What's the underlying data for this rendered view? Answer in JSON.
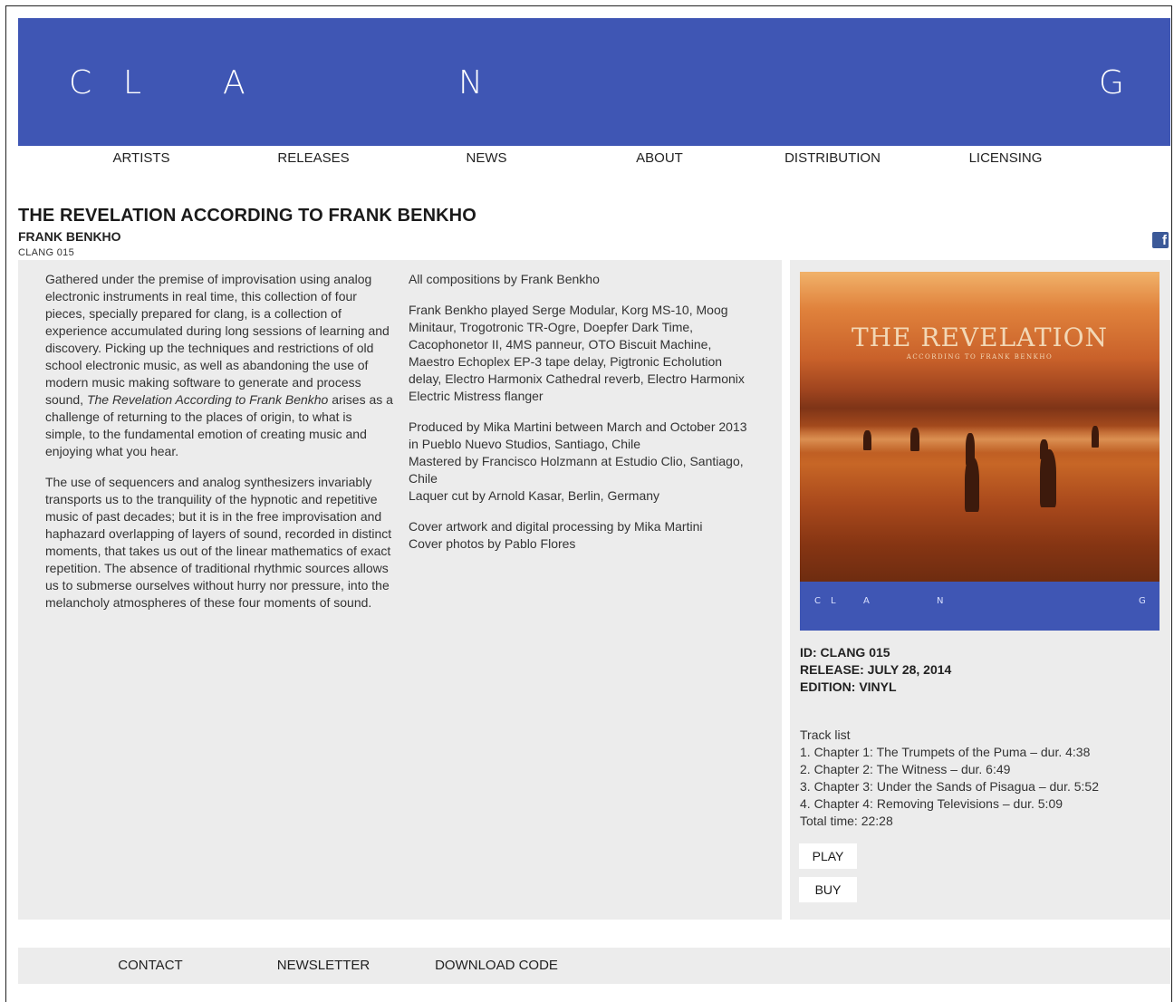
{
  "header": {
    "logo_letters": [
      "C",
      "L",
      "A",
      "N",
      "G"
    ]
  },
  "nav": {
    "items": [
      "ARTISTS",
      "RELEASES",
      "NEWS",
      "ABOUT",
      "DISTRIBUTION",
      "LICENSING"
    ]
  },
  "release": {
    "title": "THE REVELATION ACCORDING TO FRANK BENKHO",
    "artist": "FRANK BENKHO",
    "catalog": "CLANG 015"
  },
  "share": {
    "facebook_glyph": "f",
    "icon": "facebook-icon",
    "color": "#3b5998"
  },
  "description": {
    "p1_before": "Gathered under the premise of improvisation using analog electronic instruments in real time, this collection of four pieces, specially prepared for clang, is a collection of experience accumulated during long sessions of learning and discovery. Picking up the techniques and restrictions of old school electronic music, as well as abandoning the use of modern music making software to generate and process sound, ",
    "p1_italic": "The Revelation According to Frank Benkho",
    "p1_after": " arises as a challenge of returning to the places of origin, to what is simple, to the fundamental emotion of creating music and enjoying what you hear.",
    "p2": "The use of sequencers and analog synthesizers invariably transports us to the tranquility of the hypnotic and repetitive music of past decades; but it is in the free improvisation and haphazard overlapping of layers of sound, recorded in distinct moments, that takes us out of the linear mathematics of exact repetition. The absence of traditional rhythmic sources allows us to submerse ourselves without hurry nor pressure, into the melancholy atmospheres of these four moments of sound."
  },
  "credits": {
    "compositions": "All compositions by Frank Benkho",
    "instruments": "Frank Benkho played Serge Modular, Korg MS-10, Moog Minitaur, Trogotronic TR-Ogre, Doepfer Dark Time, Cacophonetor II, 4MS panneur, OTO Biscuit Machine, Maestro Echoplex EP-3 tape delay, Pigtronic Echolution delay, Electro Harmonix Cathedral reverb, Electro Harmonix Electric Mistress flanger",
    "produced": "Produced by Mika Martini between March and October 2013 in Pueblo Nuevo Studios, Santiago, Chile",
    "mastered": "Mastered by Francisco Holzmann at Estudio Clio, Santiago, Chile",
    "laquer": "Laquer cut by Arnold Kasar, Berlin, Germany",
    "artwork": "Cover artwork and digital processing by Mika Martini",
    "photos": "Cover photos by Pablo Flores"
  },
  "cover": {
    "title": "THE REVELATION",
    "subtitle": "ACCORDING TO FRANK BENKHO",
    "band_letters": [
      "C",
      "L",
      "A",
      "N",
      "G"
    ],
    "band_color": "#3f56b4"
  },
  "meta": {
    "id": "ID: CLANG 015",
    "release_date": "RELEASE: JULY 28, 2014",
    "edition": "EDITION: VINYL"
  },
  "tracklist": {
    "heading": "Track list",
    "tracks": [
      "1. Chapter 1: The Trumpets of the Puma – dur. 4:38",
      "2. Chapter 2: The Witness – dur. 6:49",
      "3. Chapter 3: Under the Sands of Pisagua – dur. 5:52",
      "4. Chapter 4: Removing Televisions – dur. 5:09"
    ],
    "total": "Total time: 22:28"
  },
  "buttons": {
    "play": "PLAY",
    "buy": "BUY"
  },
  "footer": {
    "items": [
      "CONTACT",
      "NEWSLETTER",
      "DOWNLOAD CODE"
    ]
  },
  "colors": {
    "brand_blue": "#3f56b4",
    "panel_gray": "#ececec"
  }
}
